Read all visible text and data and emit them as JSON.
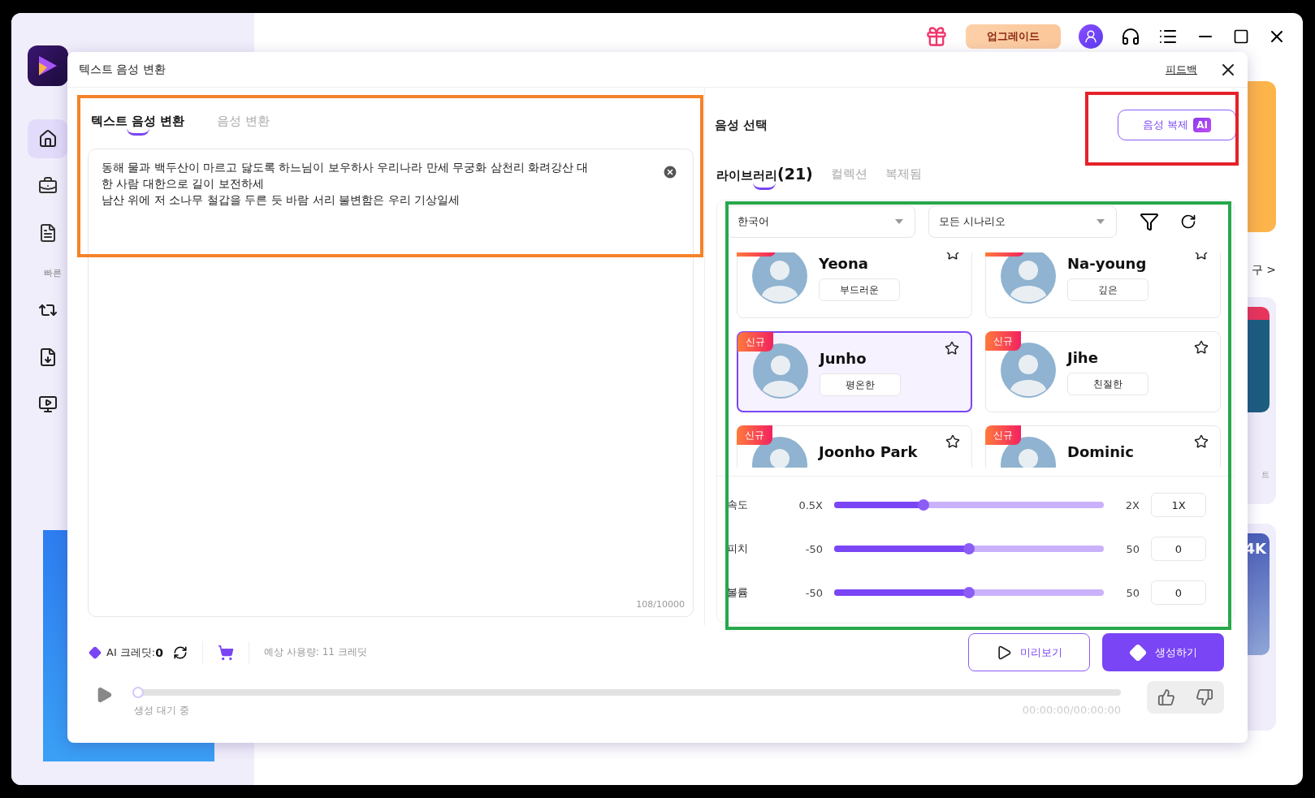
{
  "sidebar": {
    "section_label": "빠른",
    "nav": [
      {
        "kind": "home",
        "selected": true
      },
      {
        "kind": "toolbox",
        "selected": false
      },
      {
        "kind": "document",
        "selected": false
      }
    ],
    "quick": [
      {
        "kind": "convert"
      },
      {
        "kind": "import"
      },
      {
        "kind": "player"
      }
    ]
  },
  "topbar": {
    "upgrade": "업그레이드"
  },
  "background": {
    "link": "구 >",
    "caption": "트",
    "card_label": "4K"
  },
  "dialog": {
    "title": "텍스트 음성 변환",
    "feedback": "피드백",
    "tabs": [
      {
        "label": "텍스트 음성 변환",
        "selected": true
      },
      {
        "label": "음성 변환",
        "selected": false
      }
    ],
    "text": "동해 물과 백두산이 마르고 닳도록 하느님이 보우하사 우리나라 만세 무궁화 삼천리 화려강산 대한 사람 대한으로 길이 보전하세\n남산 위에 저 소나무 철갑을 두른 듯 바람 서리 불변함은 우리 기상일세",
    "counter": "108/10000",
    "voice_title": "음성 선택",
    "clone_button": "음성 복제",
    "clone_badge": "AI",
    "library_tabs": [
      {
        "label": "라이브러리",
        "count": "(21)",
        "selected": true
      },
      {
        "label": "컬렉션",
        "selected": false
      },
      {
        "label": "복제됨",
        "selected": false
      }
    ],
    "language": "한국어",
    "scenario": "모든 시나리오",
    "voices": [
      {
        "name": "Yeona",
        "tag": "부드러운",
        "new": true,
        "selected": false
      },
      {
        "name": "Na-young",
        "tag": "깊은",
        "new": true,
        "selected": false
      },
      {
        "name": "Junho",
        "tag": "평온한",
        "new": true,
        "badge": "신규",
        "selected": true
      },
      {
        "name": "Jihe",
        "tag": "친절한",
        "new": true,
        "badge": "신규",
        "selected": false
      },
      {
        "name": "Joonho Park",
        "new": true,
        "badge": "신규",
        "selected": false
      },
      {
        "name": "Dominic",
        "new": true,
        "badge": "신규",
        "selected": false
      }
    ],
    "sliders": [
      {
        "label": "속도",
        "min": "0.5X",
        "max": "2X",
        "value": "1X",
        "level": 0.33
      },
      {
        "label": "피치",
        "min": "-50",
        "max": "50",
        "value": "0",
        "level": 0.5
      },
      {
        "label": "볼륨",
        "min": "-50",
        "max": "50",
        "value": "0",
        "level": 0.5
      }
    ],
    "credits_label": "AI 크레딧:",
    "credits_value": "0",
    "estimate": "예상 사용량: 11 크레딧",
    "preview_button": "미리보기",
    "generate_button": "생성하기",
    "player": {
      "status": "생성 대기 중",
      "time": "00:00:00/00:00:00",
      "level": 0
    },
    "highlights": [
      {
        "kind": "input",
        "color": "#f5822a"
      },
      {
        "kind": "clone",
        "color": "#e52129"
      },
      {
        "kind": "library",
        "color": "#27a84a"
      }
    ]
  }
}
